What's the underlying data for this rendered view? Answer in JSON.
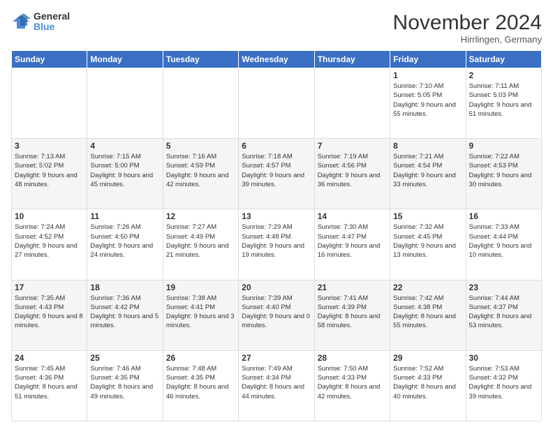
{
  "header": {
    "logo_general": "General",
    "logo_blue": "Blue",
    "title": "November 2024",
    "location": "Hirrlingen, Germany"
  },
  "days_of_week": [
    "Sunday",
    "Monday",
    "Tuesday",
    "Wednesday",
    "Thursday",
    "Friday",
    "Saturday"
  ],
  "weeks": [
    [
      {
        "day": "",
        "info": ""
      },
      {
        "day": "",
        "info": ""
      },
      {
        "day": "",
        "info": ""
      },
      {
        "day": "",
        "info": ""
      },
      {
        "day": "",
        "info": ""
      },
      {
        "day": "1",
        "info": "Sunrise: 7:10 AM\nSunset: 5:05 PM\nDaylight: 9 hours\nand 55 minutes."
      },
      {
        "day": "2",
        "info": "Sunrise: 7:11 AM\nSunset: 5:03 PM\nDaylight: 9 hours\nand 51 minutes."
      }
    ],
    [
      {
        "day": "3",
        "info": "Sunrise: 7:13 AM\nSunset: 5:02 PM\nDaylight: 9 hours\nand 48 minutes."
      },
      {
        "day": "4",
        "info": "Sunrise: 7:15 AM\nSunset: 5:00 PM\nDaylight: 9 hours\nand 45 minutes."
      },
      {
        "day": "5",
        "info": "Sunrise: 7:16 AM\nSunset: 4:59 PM\nDaylight: 9 hours\nand 42 minutes."
      },
      {
        "day": "6",
        "info": "Sunrise: 7:18 AM\nSunset: 4:57 PM\nDaylight: 9 hours\nand 39 minutes."
      },
      {
        "day": "7",
        "info": "Sunrise: 7:19 AM\nSunset: 4:56 PM\nDaylight: 9 hours\nand 36 minutes."
      },
      {
        "day": "8",
        "info": "Sunrise: 7:21 AM\nSunset: 4:54 PM\nDaylight: 9 hours\nand 33 minutes."
      },
      {
        "day": "9",
        "info": "Sunrise: 7:22 AM\nSunset: 4:53 PM\nDaylight: 9 hours\nand 30 minutes."
      }
    ],
    [
      {
        "day": "10",
        "info": "Sunrise: 7:24 AM\nSunset: 4:52 PM\nDaylight: 9 hours\nand 27 minutes."
      },
      {
        "day": "11",
        "info": "Sunrise: 7:26 AM\nSunset: 4:50 PM\nDaylight: 9 hours\nand 24 minutes."
      },
      {
        "day": "12",
        "info": "Sunrise: 7:27 AM\nSunset: 4:49 PM\nDaylight: 9 hours\nand 21 minutes."
      },
      {
        "day": "13",
        "info": "Sunrise: 7:29 AM\nSunset: 4:48 PM\nDaylight: 9 hours\nand 19 minutes."
      },
      {
        "day": "14",
        "info": "Sunrise: 7:30 AM\nSunset: 4:47 PM\nDaylight: 9 hours\nand 16 minutes."
      },
      {
        "day": "15",
        "info": "Sunrise: 7:32 AM\nSunset: 4:45 PM\nDaylight: 9 hours\nand 13 minutes."
      },
      {
        "day": "16",
        "info": "Sunrise: 7:33 AM\nSunset: 4:44 PM\nDaylight: 9 hours\nand 10 minutes."
      }
    ],
    [
      {
        "day": "17",
        "info": "Sunrise: 7:35 AM\nSunset: 4:43 PM\nDaylight: 9 hours\nand 8 minutes."
      },
      {
        "day": "18",
        "info": "Sunrise: 7:36 AM\nSunset: 4:42 PM\nDaylight: 9 hours\nand 5 minutes."
      },
      {
        "day": "19",
        "info": "Sunrise: 7:38 AM\nSunset: 4:41 PM\nDaylight: 9 hours\nand 3 minutes."
      },
      {
        "day": "20",
        "info": "Sunrise: 7:39 AM\nSunset: 4:40 PM\nDaylight: 9 hours\nand 0 minutes."
      },
      {
        "day": "21",
        "info": "Sunrise: 7:41 AM\nSunset: 4:39 PM\nDaylight: 8 hours\nand 58 minutes."
      },
      {
        "day": "22",
        "info": "Sunrise: 7:42 AM\nSunset: 4:38 PM\nDaylight: 8 hours\nand 55 minutes."
      },
      {
        "day": "23",
        "info": "Sunrise: 7:44 AM\nSunset: 4:37 PM\nDaylight: 8 hours\nand 53 minutes."
      }
    ],
    [
      {
        "day": "24",
        "info": "Sunrise: 7:45 AM\nSunset: 4:36 PM\nDaylight: 8 hours\nand 51 minutes."
      },
      {
        "day": "25",
        "info": "Sunrise: 7:46 AM\nSunset: 4:35 PM\nDaylight: 8 hours\nand 49 minutes."
      },
      {
        "day": "26",
        "info": "Sunrise: 7:48 AM\nSunset: 4:35 PM\nDaylight: 8 hours\nand 46 minutes."
      },
      {
        "day": "27",
        "info": "Sunrise: 7:49 AM\nSunset: 4:34 PM\nDaylight: 8 hours\nand 44 minutes."
      },
      {
        "day": "28",
        "info": "Sunrise: 7:50 AM\nSunset: 4:33 PM\nDaylight: 8 hours\nand 42 minutes."
      },
      {
        "day": "29",
        "info": "Sunrise: 7:52 AM\nSunset: 4:33 PM\nDaylight: 8 hours\nand 40 minutes."
      },
      {
        "day": "30",
        "info": "Sunrise: 7:53 AM\nSunset: 4:32 PM\nDaylight: 8 hours\nand 39 minutes."
      }
    ]
  ]
}
